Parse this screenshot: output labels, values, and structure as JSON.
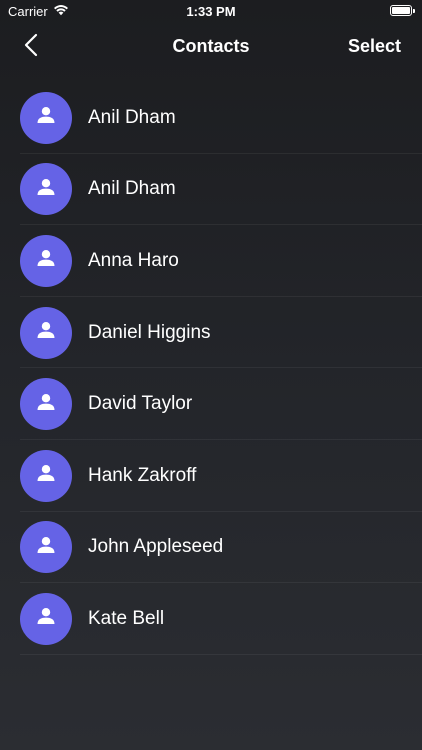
{
  "status_bar": {
    "carrier": "Carrier",
    "time": "1:33 PM"
  },
  "nav": {
    "title": "Contacts",
    "select_label": "Select"
  },
  "contacts": [
    {
      "name": "Anil Dham"
    },
    {
      "name": "Anil Dham"
    },
    {
      "name": "Anna Haro"
    },
    {
      "name": "Daniel Higgins"
    },
    {
      "name": "David Taylor"
    },
    {
      "name": "Hank Zakroff"
    },
    {
      "name": "John Appleseed"
    },
    {
      "name": "Kate Bell"
    }
  ],
  "colors": {
    "avatar": "#6563e6",
    "background": "#1c1d20",
    "text": "#ffffff"
  },
  "icons": {
    "avatar_icon": "person-icon",
    "back_icon": "chevron-left-icon",
    "wifi_icon": "wifi-icon",
    "battery_icon": "battery-icon"
  }
}
